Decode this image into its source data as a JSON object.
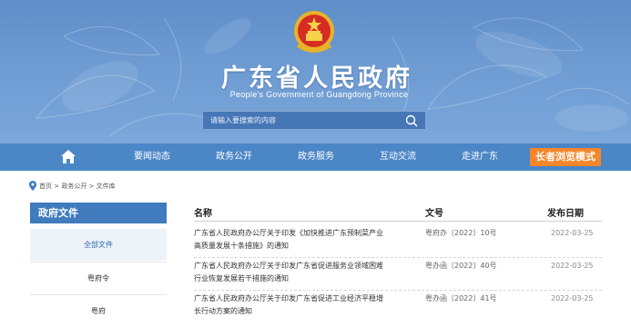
{
  "header": {
    "title": "广东省人民政府",
    "subtitle": "People's Government of Guangdong Province",
    "search_placeholder": "请输入要搜索的内容",
    "emblem_icon": "national-emblem-icon"
  },
  "nav": {
    "home_icon": "home-icon",
    "items": [
      "要闻动态",
      "政务公开",
      "政务服务",
      "互动交流",
      "走进广东"
    ],
    "elder_mode": "长者浏览模式"
  },
  "breadcrumb": {
    "icon": "location-pin-icon",
    "text": "首页 > 政务公开 > 文件库"
  },
  "sidebar": {
    "heading": "政府文件",
    "items": [
      {
        "label": "全部文件",
        "active": true
      },
      {
        "label": "粤府令",
        "active": false
      },
      {
        "label": "粤府",
        "active": false
      }
    ]
  },
  "table": {
    "headers": {
      "name": "名称",
      "doc_no": "文号",
      "date": "发布日期"
    },
    "rows": [
      {
        "title_line1": "广东省人民政府办公厅关于印发《加快推进广东预制菜产业",
        "title_line2": "高质量发展十条措施》的通知",
        "doc_no": "粤府办〔2022〕10号",
        "date": "2022-03-25"
      },
      {
        "title_line1": "广东省人民政府办公厅关于印发广东省促进服务业领域困难",
        "title_line2": "行业恢复发展若干措施的通知",
        "doc_no": "粤办函〔2022〕40号",
        "date": "2022-03-25"
      },
      {
        "title_line1": "广东省人民政府办公厅关于印发广东省促进工业经济平稳增",
        "title_line2": "长行动方案的通知",
        "doc_no": "粤办函〔2022〕41号",
        "date": "2022-03-25"
      }
    ]
  },
  "colors": {
    "banner": "#6d9bd2",
    "nav": "#4b86c7",
    "sidebar_head": "#3f7bbd",
    "elder_button": "#f5862a"
  }
}
